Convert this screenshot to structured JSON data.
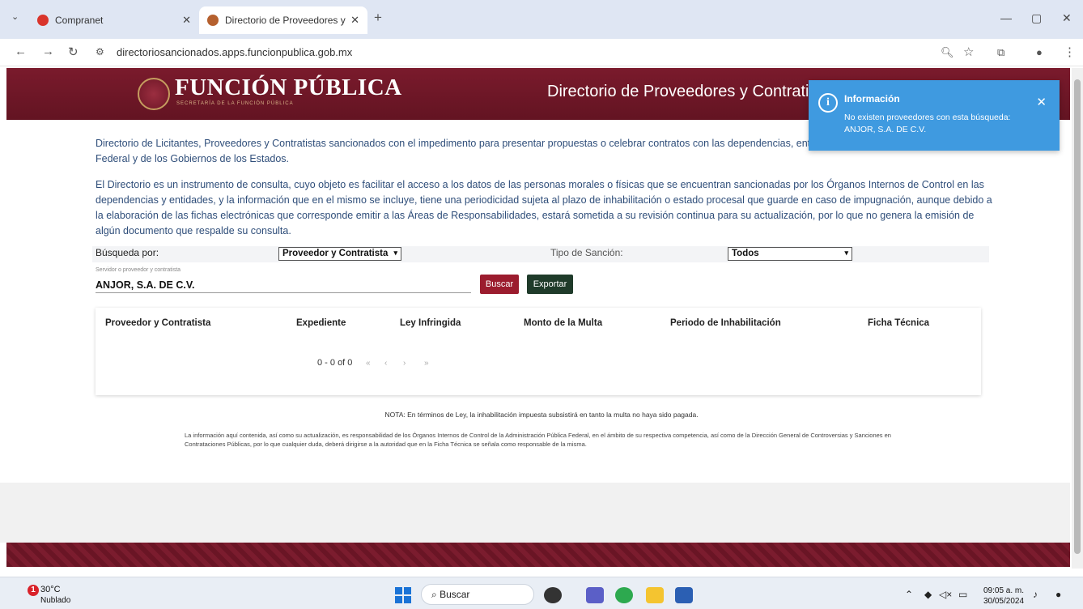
{
  "browser": {
    "tabs": [
      {
        "label": "Compranet",
        "active": false
      },
      {
        "label": "Directorio de Proveedores y Co",
        "active": true
      }
    ],
    "url": "directoriosancionados.apps.funcionpublica.gob.mx"
  },
  "header": {
    "brand": "FUNCIÓN PÚBLICA",
    "brand_sub": "SECRETARÍA DE LA FUNCIÓN PÚBLICA",
    "title": "Directorio de Proveedores y Contratistas"
  },
  "toast": {
    "title": "Información",
    "message": "No existen proveedores con esta búsqueda: ANJOR, S.A. DE C.V."
  },
  "intro": {
    "p1": "Directorio de Licitantes, Proveedores y Contratistas sancionados con el impedimento para presentar propuestas o celebrar contratos con las dependencias, entidades de la Administración Pública Federal y de los Gobiernos de los Estados.",
    "p2": "El Directorio es un instrumento de consulta, cuyo objeto es facilitar el acceso a los datos de las personas morales o físicas que se encuentran sancionadas por los Órganos Internos de Control en las dependencias y entidades, y la información que en el mismo se incluye, tiene una periodicidad sujeta al plazo de inhabilitación o estado procesal que guarde en caso de impugnación, aunque debido a la elaboración de las fichas electrónicas que corresponde emitir a las Áreas de Responsabilidades, estará sometida a su revisión continua para su actualización, por lo que no genera la emisión de algún documento que respalde su consulta."
  },
  "search": {
    "by_label": "Búsqueda por:",
    "by_value": "Proveedor y Contratista",
    "type_label": "Tipo de Sanción:",
    "type_value": "Todos",
    "hint": "Servidor o proveedor y contratista",
    "query": "ANJOR, S.A. DE C.V.",
    "search_button": "Buscar",
    "export_button": "Exportar"
  },
  "table": {
    "headers": [
      "Proveedor y Contratista",
      "Expediente",
      "Ley Infringida",
      "Monto de la Multa",
      "Periodo de Inhabilitación",
      "Ficha Técnica"
    ],
    "pager": "0 - 0 of 0",
    "pager_controls": [
      "«",
      "‹",
      "›",
      "»"
    ]
  },
  "nota": "NOTA: En términos de Ley, la inhabilitación impuesta subsistirá en tanto la multa no haya sido pagada.",
  "disclaimer": "La información aquí contenida, así como su actualización, es responsabilidad de los Órganos Internos de Control de la Administración Pública Federal, en el ámbito de su respectiva competencia, así como de la Dirección General de Controversias y Sanciones en Contrataciones Públicas, por lo que cualquier duda, deberá dirigirse a la autoridad que en la Ficha Técnica se señala como responsable de la misma.",
  "taskbar": {
    "weather_badge": "1",
    "temp": "30°C",
    "condition": "Nublado",
    "search_placeholder": "Buscar",
    "time": "09:05 a. m.",
    "date": "30/05/2024"
  },
  "colors": {
    "brand": "#6d1626",
    "toast": "#3f9ae0",
    "search_btn": "#9b1c2e",
    "export_btn": "#1f3b2a"
  }
}
